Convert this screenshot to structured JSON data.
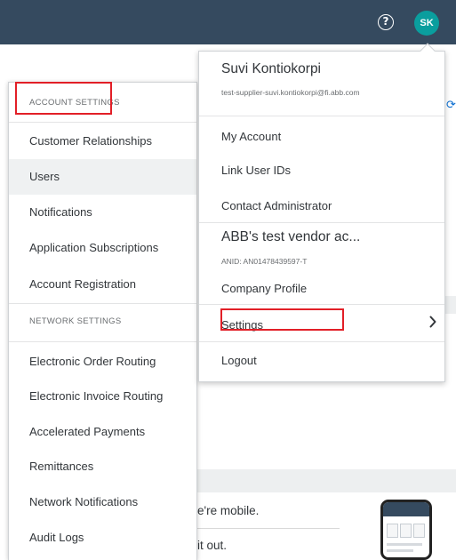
{
  "header": {
    "help_icon": "help-circle-icon",
    "avatar_initials": "SK",
    "avatar_color": "#0a9e9e",
    "bar_color": "#354a5f"
  },
  "account_menu": {
    "section_account": "ACCOUNT SETTINGS",
    "account_items": [
      {
        "label": "Customer Relationships"
      },
      {
        "label": "Users"
      },
      {
        "label": "Notifications"
      },
      {
        "label": "Application Subscriptions"
      },
      {
        "label": "Account Registration"
      }
    ],
    "section_network": "NETWORK SETTINGS",
    "network_items": [
      {
        "label": "Electronic Order Routing"
      },
      {
        "label": "Electronic Invoice Routing"
      },
      {
        "label": "Accelerated Payments"
      },
      {
        "label": "Remittances"
      },
      {
        "label": "Network Notifications"
      },
      {
        "label": "Audit Logs"
      }
    ]
  },
  "user_menu": {
    "name": "Suvi Kontiokorpi",
    "email": "test-supplier-suvi.kontiokorpi@fi.abb.com",
    "items": [
      {
        "label": "My Account"
      },
      {
        "label": "Link User IDs"
      },
      {
        "label": "Contact Administrator"
      }
    ],
    "company": "ABB's test vendor ac...",
    "anid": "ANID: AN01478439597-T",
    "company_profile": "Company Profile",
    "settings": "Settings",
    "logout": "Logout"
  },
  "background": {
    "mobile_text": "e're mobile.",
    "check_text": "it out."
  },
  "annotation_color": "#e21f27"
}
